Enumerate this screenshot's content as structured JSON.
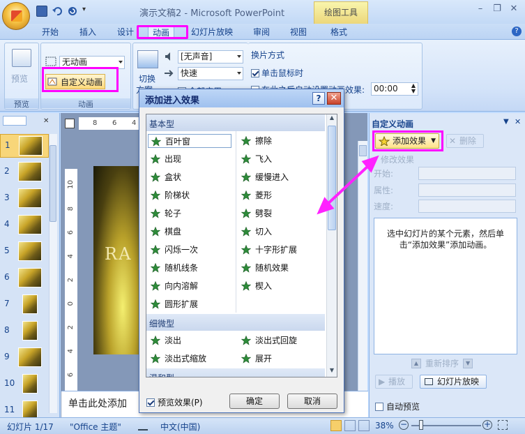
{
  "window": {
    "title": "演示文稿2 - Microsoft PowerPoint",
    "context_tab": "绘图工具",
    "min": "–",
    "restore": "❐",
    "close": "✕"
  },
  "tabs": [
    "开始",
    "插入",
    "设计",
    "动画",
    "幻灯片放映",
    "审阅",
    "视图",
    "格式"
  ],
  "ribbon": {
    "preview_group": {
      "button": "预览",
      "label": "预览"
    },
    "animation_group": {
      "anim_value": "无动画",
      "custom_anim": "自定义动画",
      "label": "动画"
    },
    "transition_group": {
      "switch_label_1": "切换",
      "switch_label_2": "方案",
      "sound": "[无声音]",
      "speed": "快速",
      "apply_all": "全部应用"
    },
    "switch_mode": {
      "title": "换片方式",
      "on_click": "单击鼠标时",
      "after_label": "在此之后自动设置动画效果:",
      "after_value": "00:00"
    }
  },
  "slides": [
    {
      "num": "1"
    },
    {
      "num": "2"
    },
    {
      "num": "3"
    },
    {
      "num": "4"
    },
    {
      "num": "5"
    },
    {
      "num": "6"
    },
    {
      "num": "7"
    },
    {
      "num": "8"
    },
    {
      "num": "9"
    },
    {
      "num": "10"
    },
    {
      "num": "11"
    }
  ],
  "ruler": {
    "h": [
      "8",
      "6",
      "4"
    ],
    "v": [
      "10",
      "8",
      "6",
      "4",
      "2",
      "0",
      "2",
      "4",
      "6"
    ]
  },
  "slide_text": "RA",
  "notes_placeholder": "单击此处添加",
  "task_pane": {
    "title": "自定义动画",
    "add_effect": "添加效果",
    "remove": "删除",
    "modify_label": "修改效果",
    "start": "开始:",
    "property": "属性:",
    "speed": "速度:",
    "info": "选中幻灯片的某个元素，然后单击“添加效果”添加动画。",
    "reorder": "重新排序",
    "play": "播放",
    "slideshow": "幻灯片放映",
    "autopreview": "自动预览"
  },
  "dialog": {
    "title": "添加进入效果",
    "help": "?",
    "close": "✕",
    "categories": [
      "基本型",
      "细微型",
      "温和型"
    ],
    "basic_left": [
      "百叶窗",
      "出现",
      "盒状",
      "阶梯状",
      "轮子",
      "棋盘",
      "闪烁一次",
      "随机线条",
      "向内溶解",
      "圆形扩展"
    ],
    "basic_right": [
      "擦除",
      "飞入",
      "缓慢进入",
      "菱形",
      "劈裂",
      "切入",
      "十字形扩展",
      "随机效果",
      "楔入"
    ],
    "subtle_left": [
      "淡出",
      "淡出式缩放"
    ],
    "subtle_right": [
      "淡出式回旋",
      "展开"
    ],
    "preview_label": "预览效果(P)",
    "ok": "确定",
    "cancel": "取消"
  },
  "status": {
    "slide": "幻灯片 1/17",
    "theme": "\"Office 主题\"",
    "lang": "中文(中国)",
    "zoom": "38%"
  },
  "colors": {
    "highlight": "#ff00ff",
    "star_green": "#2e8b3a"
  }
}
